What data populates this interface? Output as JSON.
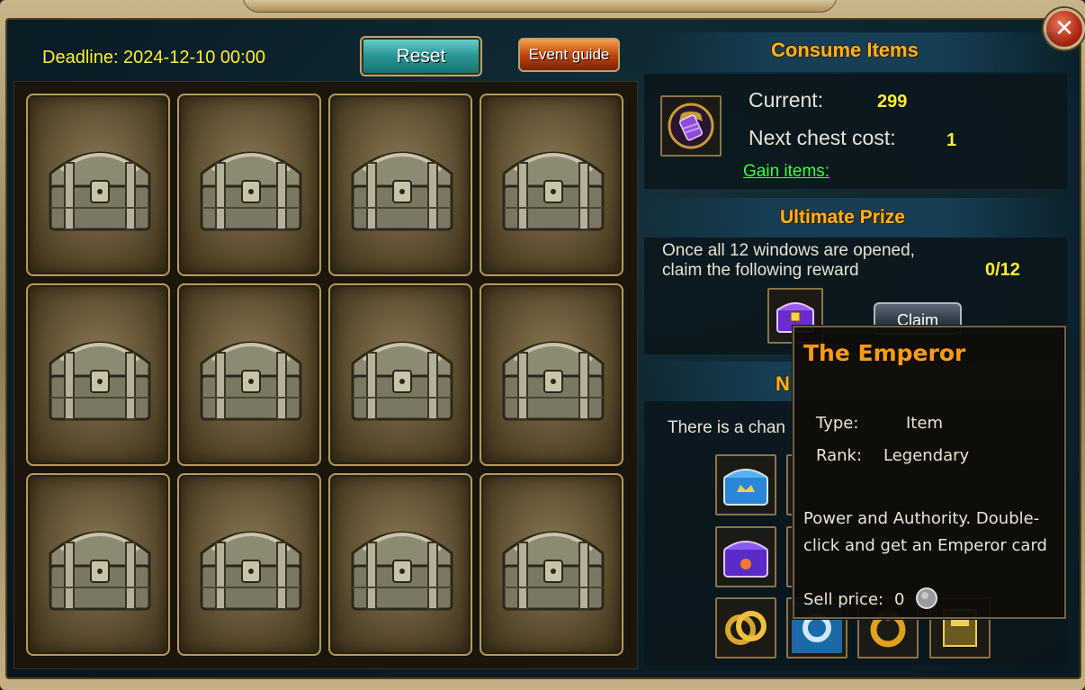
{
  "deadline": "Deadline: 2024-12-10 00:00",
  "buttons": {
    "reset": "Reset",
    "event_guide": "Event guide",
    "close": "✕",
    "claim": "Claim"
  },
  "chests": {
    "count": 12,
    "icon": "treasure-chest-icon"
  },
  "consume": {
    "title": "Consume Items",
    "current_label": "Current:",
    "current_value": "299",
    "next_label": "Next chest cost:",
    "next_value": "1",
    "gain_link": "Gain items:",
    "icon": "gem-token-icon"
  },
  "ultimate": {
    "title": "Ultimate Prize",
    "desc_line1": "Once all 12 windows are opened,",
    "desc_line2": "claim the following reward",
    "progress": "0/12",
    "icon": "purple-chest-icon"
  },
  "next_section": {
    "title_partial": "N",
    "desc_partial": "There is a chan"
  },
  "tooltip": {
    "title": "The Emperor",
    "type_label": "Type:",
    "type_value": "Item",
    "rank_label": "Rank:",
    "rank_value": "Legendary",
    "desc": "Power and Authority. Double-click and get an Emperor card",
    "sell_label": "Sell price:",
    "sell_value": "0",
    "coin_icon": "silver-coin-icon"
  },
  "colors": {
    "deadline": "#ffee33",
    "title_gold": "#ffb51a",
    "link_green": "#3cff3c",
    "tooltip_title": "#ff9a18"
  }
}
